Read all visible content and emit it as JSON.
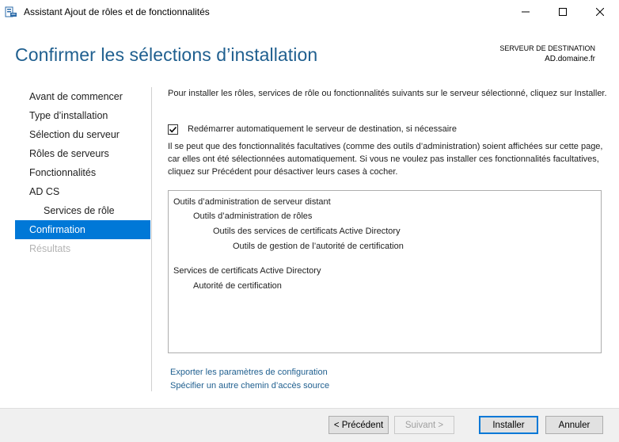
{
  "window": {
    "title": "Assistant Ajout de rôles et de fonctionnalités",
    "icon": "server-manager-icon"
  },
  "header": {
    "title": "Confirmer les sélections d’installation",
    "destination_label": "SERVEUR DE DESTINATION",
    "destination_server": "AD.domaine.fr"
  },
  "nav": {
    "items": [
      {
        "label": "Avant de commencer"
      },
      {
        "label": "Type d’installation"
      },
      {
        "label": "Sélection du serveur"
      },
      {
        "label": "Rôles de serveurs"
      },
      {
        "label": "Fonctionnalités"
      },
      {
        "label": "AD CS"
      },
      {
        "label": "Services de rôle"
      },
      {
        "label": "Confirmation"
      },
      {
        "label": "Résultats"
      }
    ]
  },
  "content": {
    "intro": "Pour installer les rôles, services de rôle ou fonctionnalités suivants sur le serveur sélectionné, cliquez sur Installer.",
    "restart_label": "Redémarrer automatiquement le serveur de destination, si nécessaire",
    "restart_checked": true,
    "info": "Il se peut que des fonctionnalités facultatives (comme des outils d’administration) soient affichées sur cette page, car elles ont été sélectionnées automatiquement. Si vous ne voulez pas installer ces fonctionnalités facultatives, cliquez sur Précédent pour désactiver leurs cases à cocher.",
    "selections": [
      {
        "label": "Outils d’administration de serveur distant"
      },
      {
        "label": "Outils d’administration de rôles"
      },
      {
        "label": "Outils des services de certificats Active Directory"
      },
      {
        "label": "Outils de gestion de l’autorité de certification"
      },
      {
        "label": "Services de certificats Active Directory"
      },
      {
        "label": "Autorité de certification"
      }
    ],
    "export_link": "Exporter les paramètres de configuration",
    "source_link": "Spécifier un autre chemin d’accès source"
  },
  "buttons": {
    "previous": "< Précédent",
    "next": "Suivant >",
    "install": "Installer",
    "cancel": "Annuler"
  },
  "colors": {
    "accent": "#0078d7",
    "title": "#1f5f8f",
    "disabled": "#b3b3b3"
  }
}
